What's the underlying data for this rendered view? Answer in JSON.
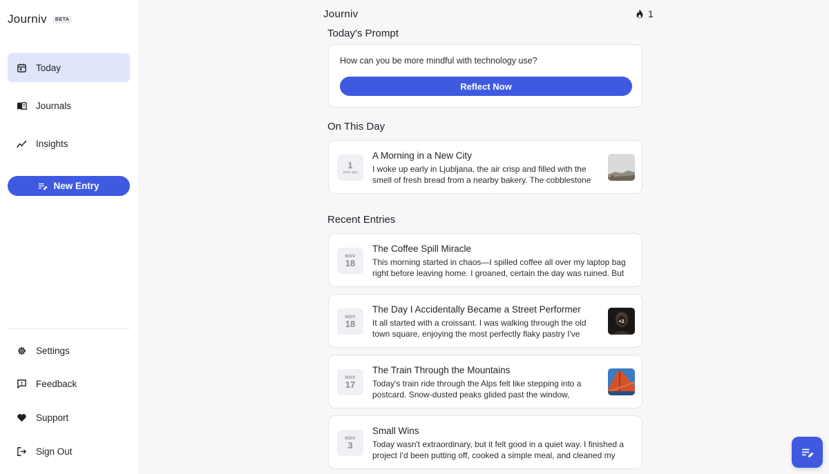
{
  "sidebar": {
    "brand": "Journiv",
    "beta": "BETA",
    "nav": [
      {
        "label": "Today",
        "icon": "calendar-icon",
        "active": true
      },
      {
        "label": "Journals",
        "icon": "book-icon",
        "active": false
      },
      {
        "label": "Insights",
        "icon": "trend-icon",
        "active": false
      }
    ],
    "new_entry": "New Entry",
    "bottom": [
      {
        "label": "Settings",
        "icon": "gear-icon"
      },
      {
        "label": "Feedback",
        "icon": "feedback-icon"
      },
      {
        "label": "Support",
        "icon": "heart-icon"
      },
      {
        "label": "Sign Out",
        "icon": "sign-out-icon"
      }
    ]
  },
  "header": {
    "title": "Journiv",
    "streak": "1"
  },
  "prompt": {
    "section": "Today's Prompt",
    "text": "How can you be more mindful with technology use?",
    "button": "Reflect Now"
  },
  "on_this_day": {
    "section": "On This Day",
    "entry": {
      "date_num": "1",
      "date_label": "year ago",
      "title": "A Morning in a New City",
      "body": "I woke up early in Ljubljana, the air crisp and filled with the smell of fresh bread from a nearby bakery. The cobblestone streets were still quiet as I wandered toward the river.",
      "thumb": "misty-landscape"
    }
  },
  "recent": {
    "section": "Recent Entries",
    "entries": [
      {
        "month": "NOV",
        "day": "18",
        "title": "The Coffee Spill Miracle",
        "body": "This morning started in chaos—I spilled coffee all over my laptop bag right before leaving home. I groaned, certain the day was ruined. But then something unexpected happened.",
        "thumb": ""
      },
      {
        "month": "NOV",
        "day": "18",
        "title": "The Day I Accidentally Became a Street Performer",
        "body": "It all started with a croissant. I was walking through the old town square, enjoying the most perfectly flaky pastry I've ever had, when a musician waved me over.",
        "thumb": "portrait",
        "thumb_badge": "+2"
      },
      {
        "month": "NOV",
        "day": "17",
        "title": "The Train Through the Mountains",
        "body": "Today's train ride through the Alps felt like stepping into a postcard. Snow-dusted peaks glided past the window, intense blue sky above every valley.",
        "thumb": "bridge"
      },
      {
        "month": "NOV",
        "day": "3",
        "title": "Small Wins",
        "body": "Today wasn't extraordinary, but it felt good in a quiet way. I finished a project I'd been putting off, cooked a simple meal, and cleaned my desk before dinner.",
        "thumb": ""
      }
    ]
  },
  "colors": {
    "accent": "#3f5ae0",
    "active_nav_bg": "#dfe5fb"
  }
}
